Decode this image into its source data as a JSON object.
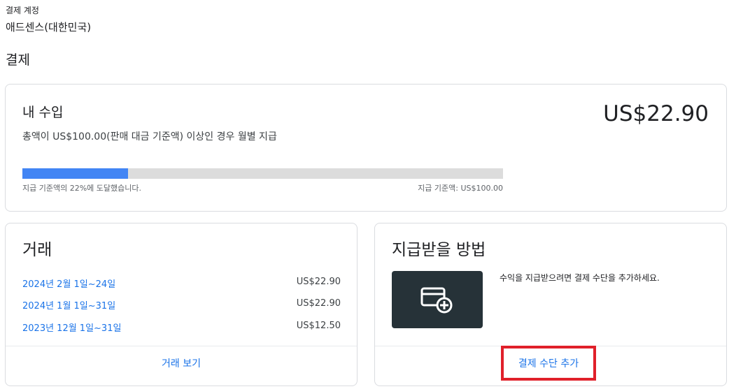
{
  "account": {
    "label": "결제 계정",
    "name": "애드센스(대한민국)"
  },
  "section_title": "결제",
  "earnings": {
    "title": "내 수입",
    "description": "총액이 US$100.00(판매 대금 기준액) 이상인 경우 월별 지급",
    "amount": "US$22.90",
    "progress_percent": 22,
    "progress_left_text": "지급 기준액의 22%에 도달했습니다.",
    "progress_right_text": "지급 기준액: US$100.00",
    "colors": {
      "progress_fill": "#4285f4",
      "progress_track": "#dcdcdc"
    }
  },
  "transactions": {
    "title": "거래",
    "rows": [
      {
        "date": "2024년 2월 1일~24일",
        "amount": "US$22.90"
      },
      {
        "date": "2024년 1월 1일~31일",
        "amount": "US$22.90"
      },
      {
        "date": "2023년 12월 1일~31일",
        "amount": "US$12.50"
      }
    ],
    "view_link": "거래 보기"
  },
  "payment_method": {
    "title": "지급받을 방법",
    "icon": "add-card-icon",
    "message": "수익을 지급받으려면 결제 수단을 추가하세요.",
    "add_link": "결제 수단 추가",
    "colors": {
      "tile": "#263238",
      "highlight_border": "#e0202a",
      "link": "#1a73e8"
    }
  }
}
